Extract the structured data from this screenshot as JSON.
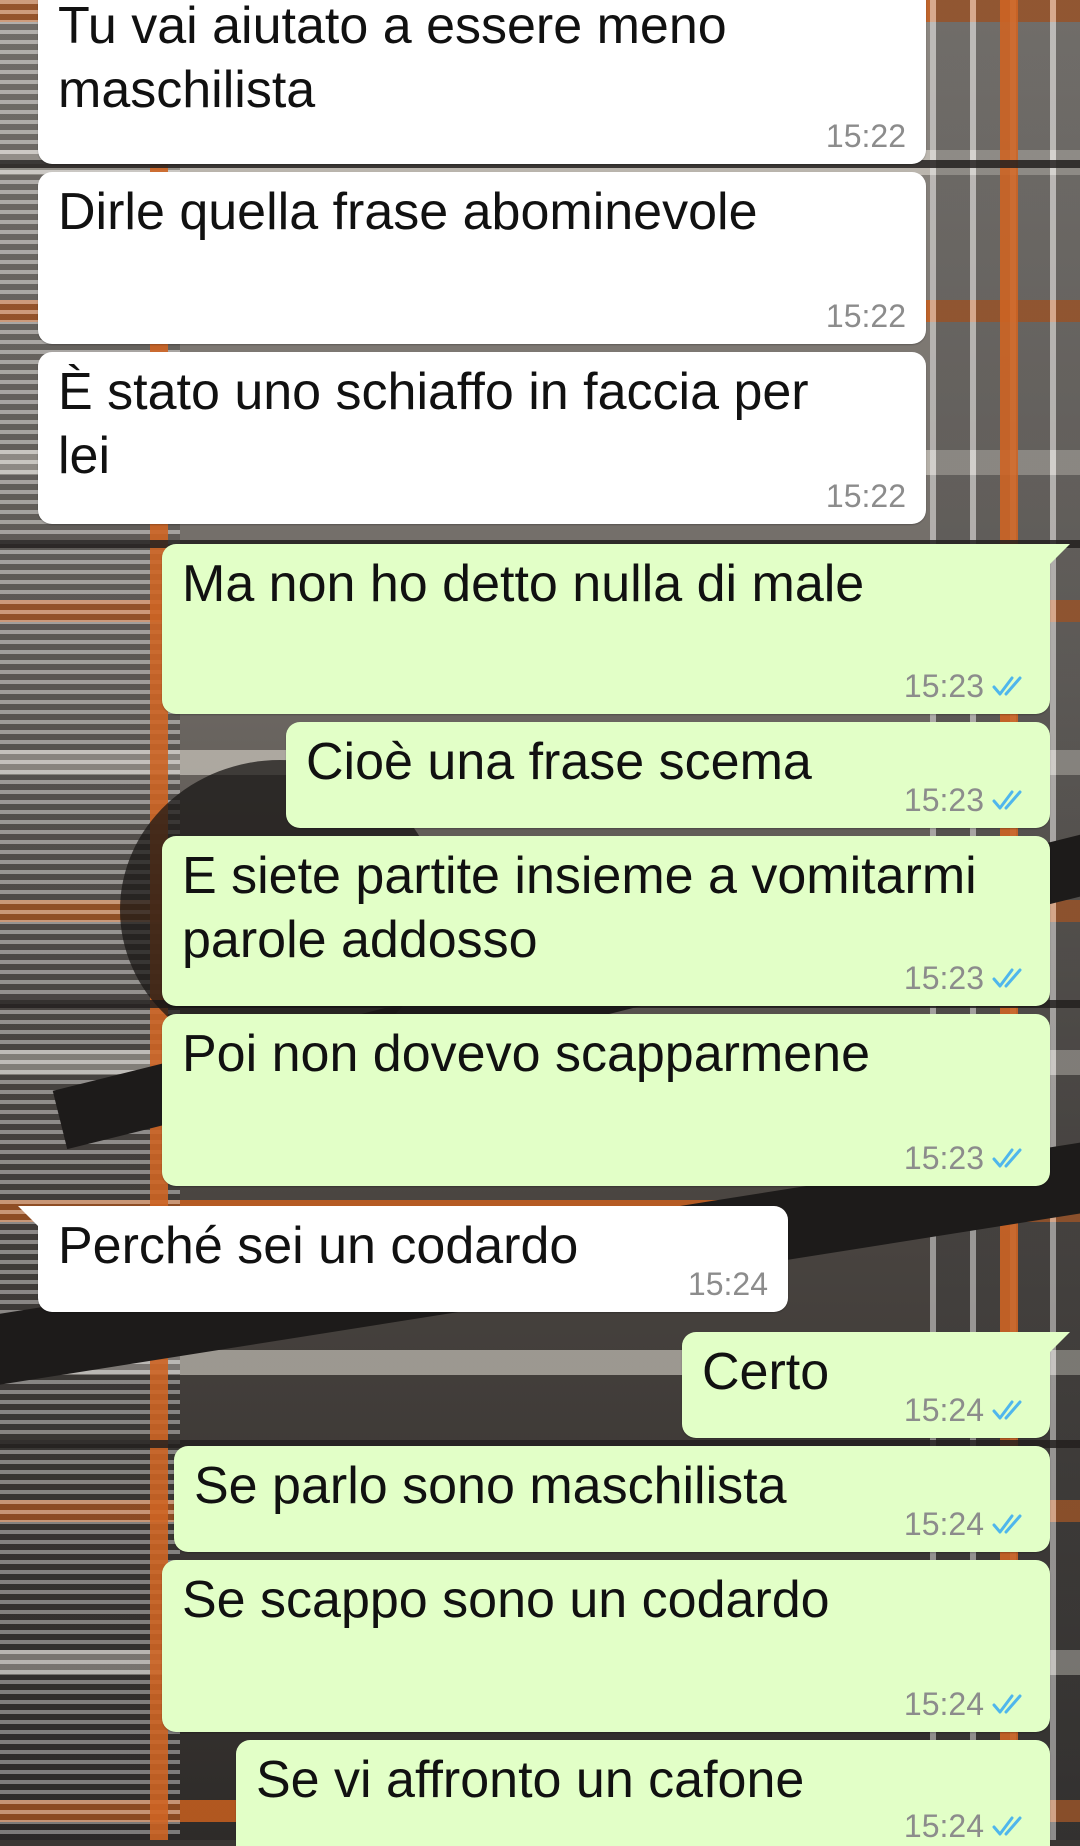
{
  "colors": {
    "incoming_bubble": "#ffffff",
    "outgoing_bubble": "#e2ffc7",
    "timestamp": "#8c8c8c",
    "read_ticks": "#4fb6ec"
  },
  "messages": [
    {
      "direction": "in",
      "text": "Tu vai aiutato a essere meno\nmaschilista",
      "time": "15:22"
    },
    {
      "direction": "in",
      "text": "Dirle quella frase abominevole",
      "time": "15:22"
    },
    {
      "direction": "in",
      "text": "È stato uno schiaffo in faccia per\nlei",
      "time": "15:22"
    },
    {
      "direction": "out",
      "text": "Ma non ho detto nulla di male",
      "time": "15:23",
      "status_icon": "double-check-read-icon"
    },
    {
      "direction": "out",
      "text": "Cioè una frase scema",
      "time": "15:23",
      "status_icon": "double-check-read-icon"
    },
    {
      "direction": "out",
      "text": "E siete partite insieme a vomitarmi\nparole addosso",
      "time": "15:23",
      "status_icon": "double-check-read-icon"
    },
    {
      "direction": "out",
      "text": "Poi non dovevo scapparmene",
      "time": "15:23",
      "status_icon": "double-check-read-icon"
    },
    {
      "direction": "in",
      "text": "Perché sei un codardo",
      "time": "15:24"
    },
    {
      "direction": "out",
      "text": "Certo",
      "time": "15:24",
      "status_icon": "double-check-read-icon"
    },
    {
      "direction": "out",
      "text": "Se parlo sono maschilista",
      "time": "15:24",
      "status_icon": "double-check-read-icon"
    },
    {
      "direction": "out",
      "text": "Se scappo sono un codardo",
      "time": "15:24",
      "status_icon": "double-check-read-icon"
    },
    {
      "direction": "out",
      "text": "Se vi affronto un cafone",
      "time": "15:24",
      "status_icon": "double-check-read-icon"
    }
  ]
}
